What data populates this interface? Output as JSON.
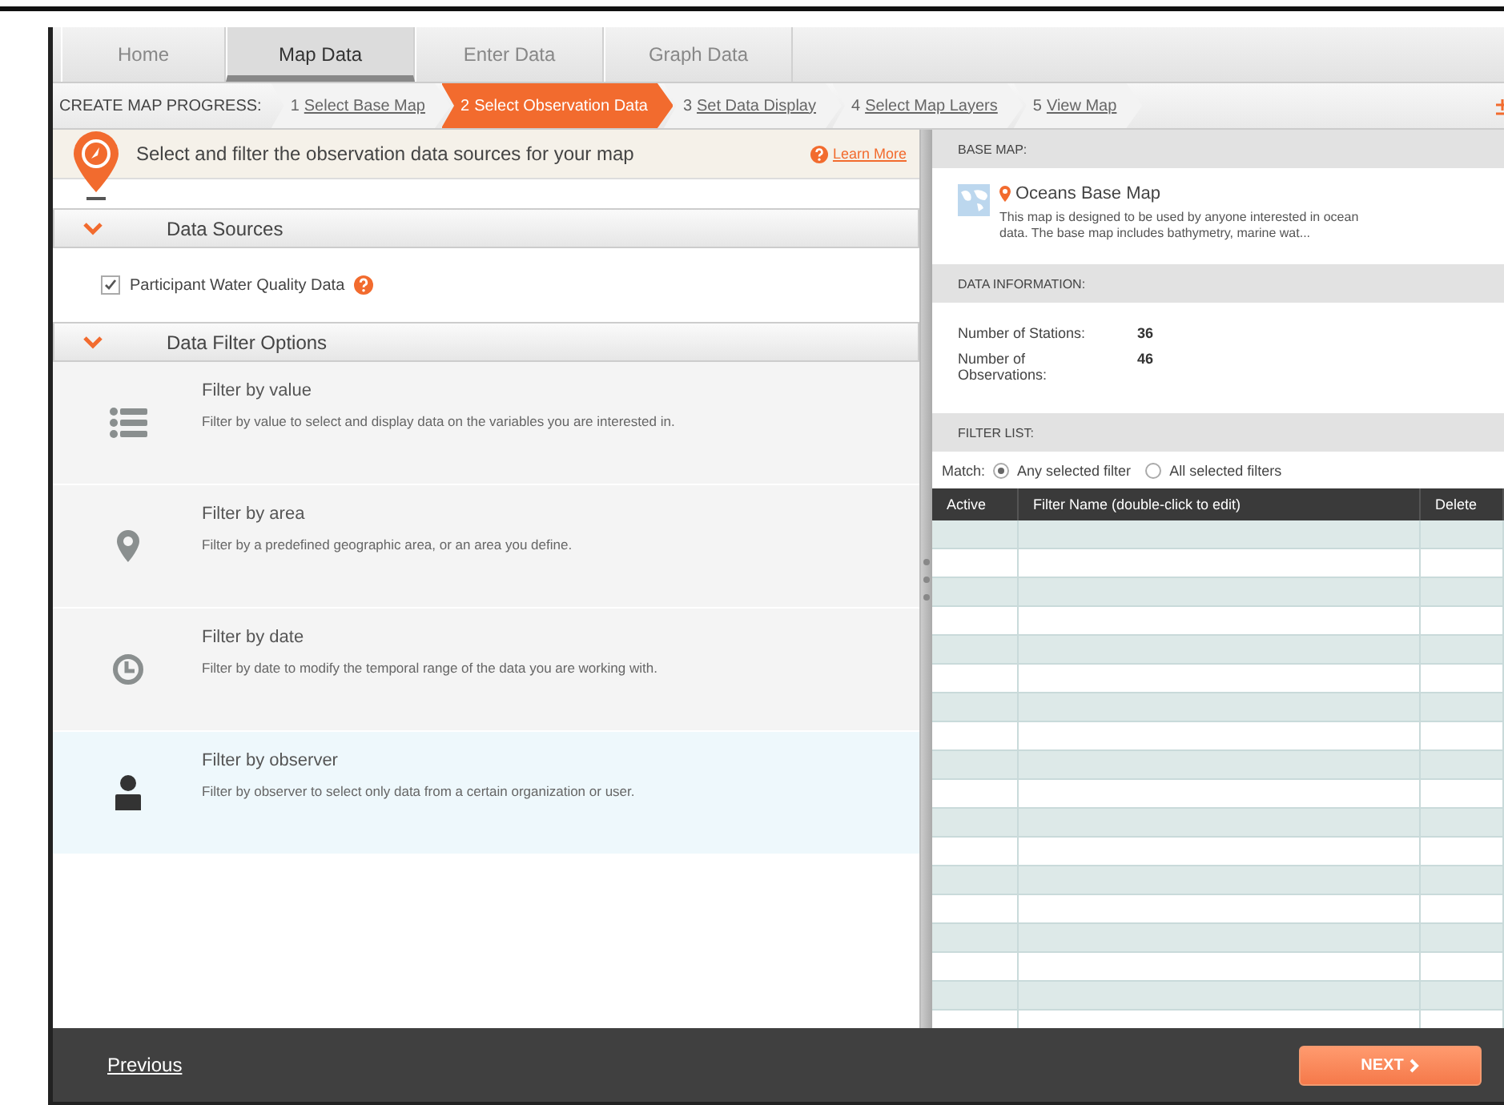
{
  "tabs": [
    {
      "label": "Home",
      "selected": false
    },
    {
      "label": "Map Data",
      "selected": true
    },
    {
      "label": "Enter Data",
      "selected": false
    },
    {
      "label": "Graph Data",
      "selected": false
    }
  ],
  "progress": {
    "label": "CREATE MAP PROGRESS:",
    "steps": [
      {
        "number": "1",
        "label": "Select Base Map",
        "selected": false
      },
      {
        "number": "2",
        "label": "Select Observation Data",
        "selected": true
      },
      {
        "number": "3",
        "label": "Set Data Display",
        "selected": false
      },
      {
        "number": "4",
        "label": "Select Map Layers",
        "selected": false
      },
      {
        "number": "5",
        "label": "View Map",
        "selected": false
      }
    ]
  },
  "intro": {
    "text": "Select and filter the observation data sources for your map",
    "link": "Learn More"
  },
  "data_sources": {
    "title": "Data Sources",
    "expanded": true,
    "items": [
      {
        "label": "Participant Water Quality Data",
        "checked": true
      }
    ]
  },
  "filter_options": {
    "title": "Data Filter Options",
    "expanded": true,
    "items": [
      {
        "kind": "value",
        "title": "Filter by value",
        "description": "Filter by value to select and display data on the variables you are interested in.",
        "selected": false
      },
      {
        "kind": "area",
        "title": "Filter by area",
        "description": "Filter by a predefined geographic area, or an area you define.",
        "selected": false
      },
      {
        "kind": "date",
        "title": "Filter by date",
        "description": "Filter by date to modify the temporal range of the data you are working with.",
        "selected": false
      },
      {
        "kind": "observer",
        "title": "Filter by observer",
        "description": "Filter by observer to select only data from a certain organization or user.",
        "selected": true
      }
    ]
  },
  "base_map": {
    "heading": "BASE MAP:",
    "name": "Oceans Base Map",
    "description": "This map is designed to be used by anyone interested in ocean data. The base map includes bathymetry, marine wat..."
  },
  "data_information": {
    "heading": "DATA INFORMATION:",
    "rows": [
      {
        "label": "Number of Stations:",
        "value": "36"
      },
      {
        "label": "Number of Observations:",
        "value": "46"
      }
    ]
  },
  "filter_list": {
    "heading": "FILTER LIST:",
    "match_label": "Match:",
    "match_options": [
      {
        "label": "Any selected filter",
        "selected": true
      },
      {
        "label": "All selected filters",
        "selected": false
      }
    ],
    "columns": [
      "Active",
      "Filter Name (double-click to edit)",
      "Delete"
    ]
  },
  "footer": {
    "previous": "Previous",
    "next": "NEXT"
  }
}
